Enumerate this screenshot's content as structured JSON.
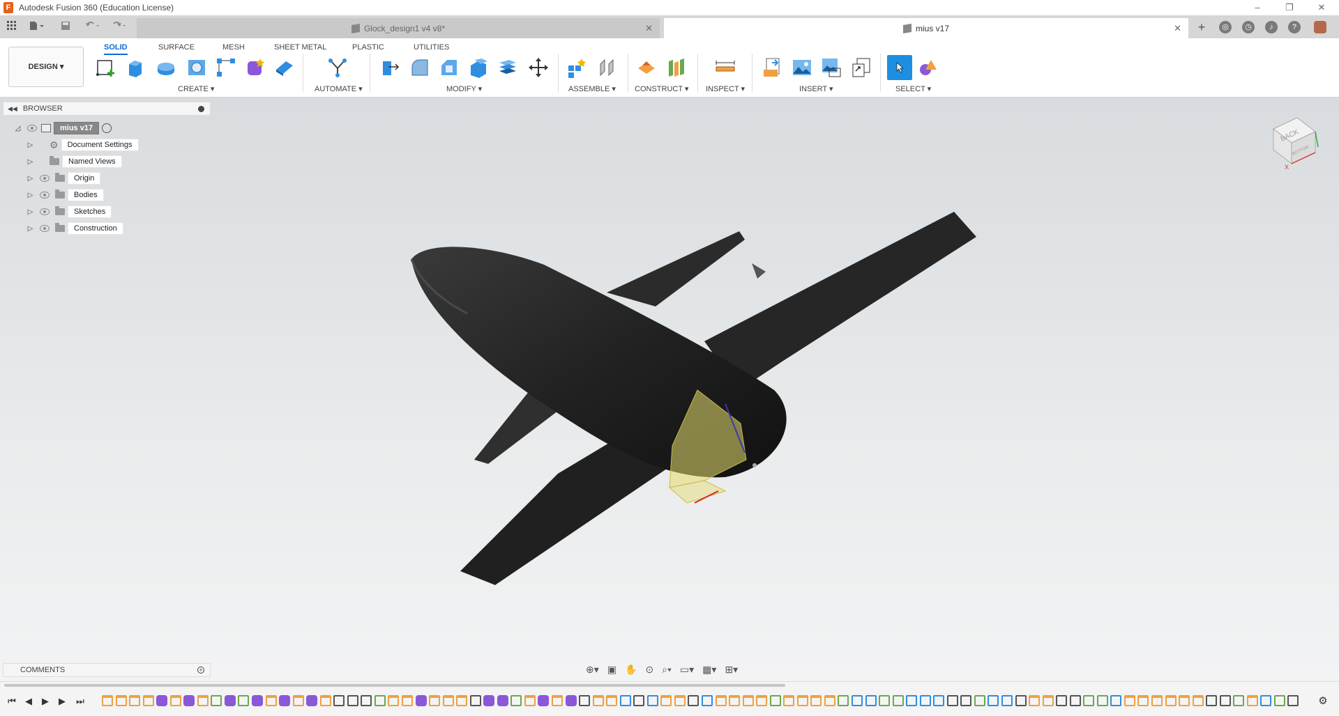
{
  "window": {
    "title": "Autodesk Fusion 360 (Education License)",
    "controls": [
      "–",
      "❐",
      "✕"
    ]
  },
  "tabs": {
    "items": [
      {
        "label": "Glock_design1 v4 v8*",
        "active": false
      },
      {
        "label": "mius v17",
        "active": true
      }
    ]
  },
  "ribbon": {
    "workspace_label": "DESIGN",
    "tabs": [
      "SOLID",
      "SURFACE",
      "MESH",
      "SHEET METAL",
      "PLASTIC",
      "UTILITIES"
    ],
    "groups": [
      "CREATE",
      "AUTOMATE",
      "MODIFY",
      "ASSEMBLE",
      "CONSTRUCT",
      "INSPECT",
      "INSERT",
      "SELECT"
    ],
    "accent": "#0b6ad6"
  },
  "browser": {
    "title": "BROWSER",
    "root": "mius v17",
    "items": [
      {
        "label": "Document Settings",
        "icon": "gear-icon"
      },
      {
        "label": "Named Views",
        "icon": "folder-icon"
      },
      {
        "label": "Origin",
        "icon": "folder-icon"
      },
      {
        "label": "Bodies",
        "icon": "folder-icon"
      },
      {
        "label": "Sketches",
        "icon": "folder-icon"
      },
      {
        "label": "Construction",
        "icon": "folder-icon"
      }
    ]
  },
  "comments": {
    "title": "COMMENTS"
  },
  "viewcube": {
    "face_label": "BACK",
    "bottom_label": "BOTTOM",
    "axis_label": "X"
  },
  "timeline": {
    "feature_count": 88
  },
  "colors": {
    "model": "#222222",
    "highlight": "#e6dc6e",
    "sketch_feature": "#f0a040",
    "body_feature": "#8a58d8",
    "construct_feature": "#6aa84f"
  }
}
